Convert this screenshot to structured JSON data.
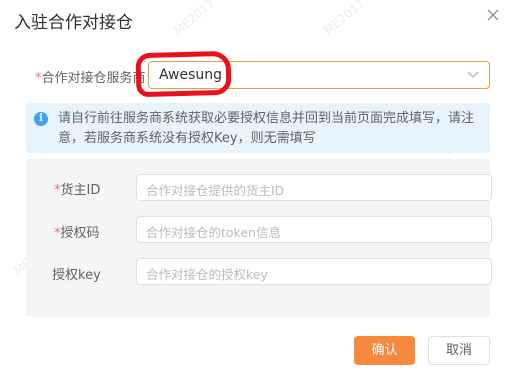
{
  "dialog": {
    "title": "入驻合作对接仓"
  },
  "form": {
    "provider": {
      "required_mark": "*",
      "label": "合作对接仓服务商",
      "value": "Awesung"
    },
    "notice": "请自行前往服务商系统获取必要授权信息并回到当前页面完成填写，请注意，若服务商系统没有授权Key，则无需填写",
    "owner_id": {
      "required_mark": "*",
      "label": "货主ID",
      "placeholder": "合作对接仓提供的货主ID"
    },
    "auth_code": {
      "required_mark": "*",
      "label": "授权码",
      "placeholder": "合作对接仓的token信息"
    },
    "auth_key": {
      "label": "授权key",
      "placeholder": "合作对接仓的授权key"
    }
  },
  "footer": {
    "confirm_label": "确认",
    "cancel_label": "取消"
  },
  "watermark": "ME2017",
  "colors": {
    "primary_button": "#f7893e",
    "select_border_focus": "#e6a23c",
    "info_icon": "#409eff",
    "alert_bg": "#e8f4fd",
    "annotation": "#e8121c",
    "required": "#f56c6c"
  }
}
